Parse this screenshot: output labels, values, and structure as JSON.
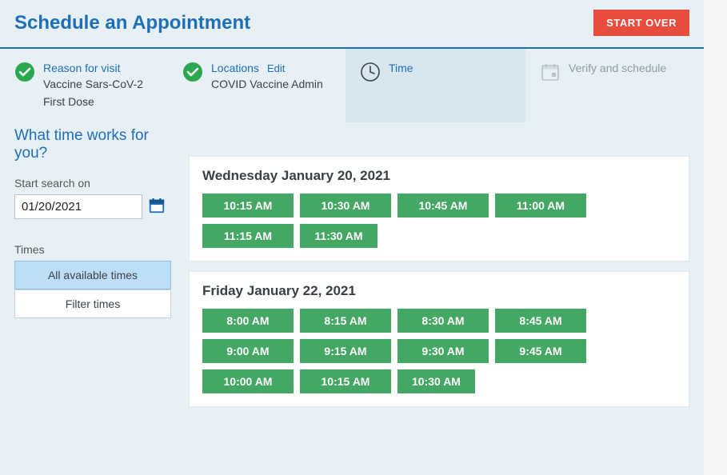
{
  "header": {
    "title": "Schedule an Appointment",
    "start_over": "START OVER"
  },
  "stepper": {
    "reason": {
      "title": "Reason for visit",
      "value_line1": "Vaccine Sars-CoV-2",
      "value_line2": "First Dose"
    },
    "locations": {
      "title": "Locations",
      "edit": "Edit",
      "value": "COVID Vaccine Admin"
    },
    "time": {
      "title": "Time"
    },
    "verify": {
      "title": "Verify and schedule"
    }
  },
  "sidebar": {
    "prompt": "What time works for you?",
    "search_label": "Start search on",
    "date_value": "01/20/2021",
    "times_label": "Times",
    "opt_all": "All available times",
    "opt_filter": "Filter times"
  },
  "results": {
    "days": [
      {
        "heading": "Wednesday January 20, 2021",
        "slots": [
          "10:15 AM",
          "10:30 AM",
          "10:45 AM",
          "11:00 AM",
          "11:15 AM",
          "11:30 AM"
        ]
      },
      {
        "heading": "Friday January 22, 2021",
        "slots": [
          "8:00 AM",
          "8:15 AM",
          "8:30 AM",
          "8:45 AM",
          "9:00 AM",
          "9:15 AM",
          "9:30 AM",
          "9:45 AM",
          "10:00 AM",
          "10:15 AM",
          "10:30 AM"
        ]
      }
    ]
  }
}
